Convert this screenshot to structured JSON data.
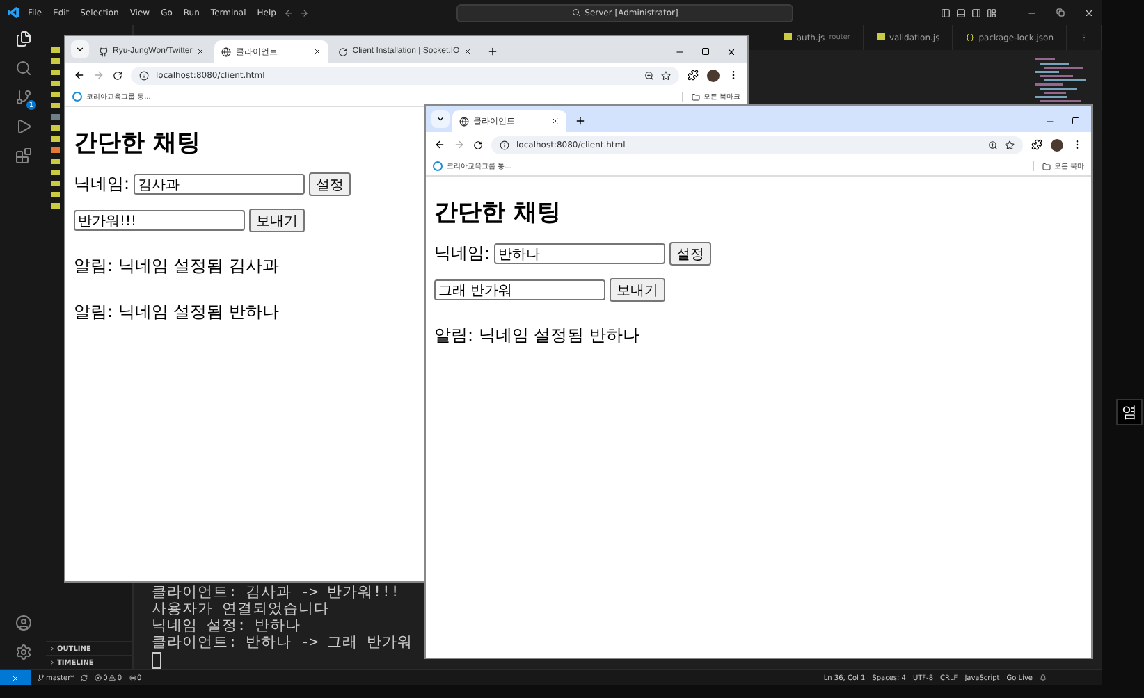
{
  "vscode": {
    "menu": [
      "File",
      "Edit",
      "Selection",
      "View",
      "Go",
      "Run",
      "Terminal",
      "Help"
    ],
    "command_center": "Server [Administrator]",
    "source_control_badge": "1",
    "editor_tabs": [
      {
        "name": "auth.js",
        "detail": "router",
        "kind": "js"
      },
      {
        "name": "validation.js",
        "kind": "js"
      },
      {
        "name": "package-lock.json",
        "kind": "json"
      }
    ],
    "sidebar_sections": [
      "OUTLINE",
      "TIMELINE"
    ],
    "terminal_lines": [
      "클라이언트: 김사과 -> 반가워!!!",
      "사용자가 연결되었습니다",
      "닉네임 설정: 반하나",
      "클라이언트: 반하나 -> 그래 반가워"
    ],
    "status_bar": {
      "branch": "master*",
      "errors": "0",
      "warnings": "0",
      "ports": "0",
      "right": [
        "Ln 36, Col 1",
        "Spaces: 4",
        "UTF-8",
        "CRLF",
        "JavaScript",
        "Go Live"
      ]
    }
  },
  "browsers": [
    {
      "active": false,
      "tabs": [
        {
          "title": "Ryu-JungWon/Twitter",
          "kind": "github",
          "selected": false
        },
        {
          "title": "클라이언트",
          "kind": "globe",
          "selected": true
        },
        {
          "title": "Client Installation | Socket.IO",
          "kind": "socket",
          "selected": false
        }
      ],
      "url": "localhost:8080/client.html",
      "bookmark": "코리아교육그룹 통...",
      "all_bookmarks": "모든 북마크",
      "page": {
        "title": "간단한 채팅",
        "nickname_label": "닉네임:",
        "nickname": "김사과",
        "set_button": "설정",
        "message": "반가워!!!",
        "send_button": "보내기",
        "notices": [
          "알림: 닉네임 설정됨 김사과",
          "알림: 닉네임 설정됨 반하나"
        ]
      }
    },
    {
      "active": true,
      "tabs": [
        {
          "title": "클라이언트",
          "kind": "globe",
          "selected": true
        }
      ],
      "url": "localhost:8080/client.html",
      "bookmark": "코리아교육그룹 통...",
      "all_bookmarks": "모든 북마",
      "page": {
        "title": "간단한 채팅",
        "nickname_label": "닉네임:",
        "nickname": "반하나",
        "set_button": "설정",
        "message": "그래 반가워",
        "send_button": "보내기",
        "notices": [
          "알림: 닉네임 설정됨 반하나"
        ]
      }
    }
  ],
  "side_text": "염"
}
